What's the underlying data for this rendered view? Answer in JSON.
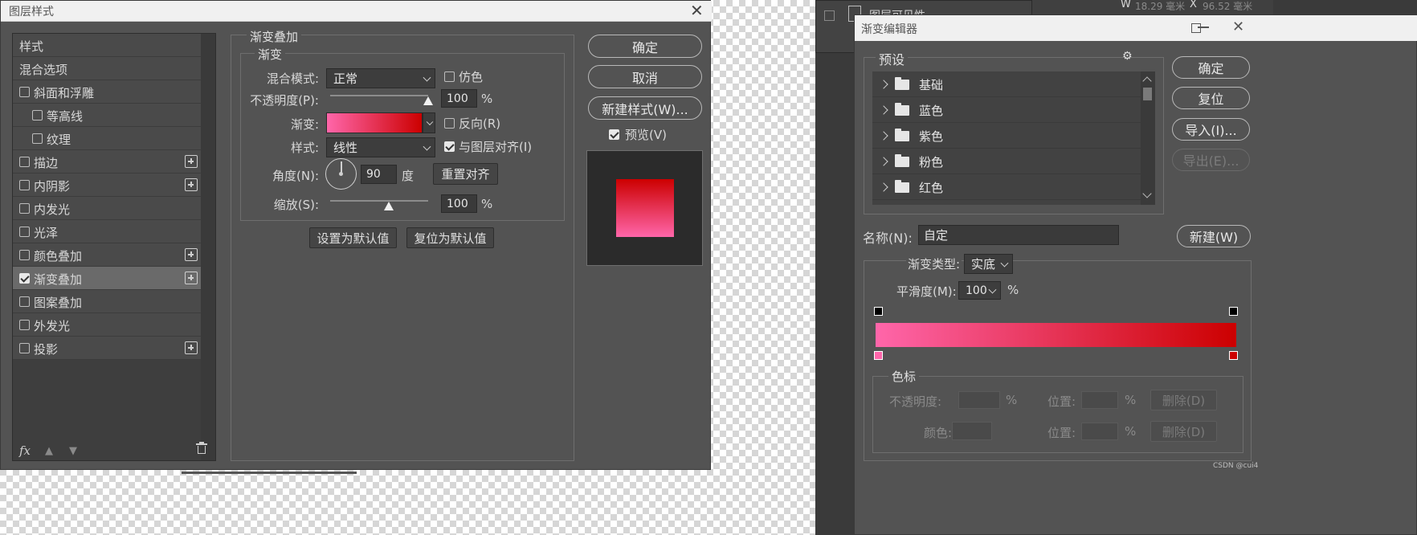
{
  "colors": {
    "panel_bg": "#535353",
    "dark_bg": "#3f3f3f",
    "gradient_start": "#ff66aa",
    "gradient_end": "#cc0000",
    "selected_row": "#6a6a6a"
  },
  "layer_style": {
    "title": "图层样式",
    "list": {
      "header": "样式",
      "blend_options": "混合选项",
      "items": [
        {
          "label": "斜面和浮雕",
          "checked": false,
          "plus": false
        },
        {
          "label": "等高线",
          "checked": false,
          "plus": false
        },
        {
          "label": "纹理",
          "checked": false,
          "plus": false
        },
        {
          "label": "描边",
          "checked": false,
          "plus": true
        },
        {
          "label": "内阴影",
          "checked": false,
          "plus": true
        },
        {
          "label": "内发光",
          "checked": false,
          "plus": false
        },
        {
          "label": "光泽",
          "checked": false,
          "plus": false
        },
        {
          "label": "颜色叠加",
          "checked": false,
          "plus": true
        },
        {
          "label": "渐变叠加",
          "checked": true,
          "plus": true
        },
        {
          "label": "图案叠加",
          "checked": false,
          "plus": false
        },
        {
          "label": "外发光",
          "checked": false,
          "plus": false
        },
        {
          "label": "投影",
          "checked": false,
          "plus": true
        }
      ],
      "fx": "fx"
    },
    "gradient_overlay": {
      "section_title": "渐变叠加",
      "group_title": "渐变",
      "blend_mode_label": "混合模式:",
      "blend_mode_value": "正常",
      "dither_label": "仿色",
      "opacity_label": "不透明度(P):",
      "opacity_value": "100",
      "opacity_unit": "%",
      "opacity_fraction": 1.0,
      "gradient_label": "渐变:",
      "reverse_label": "反向(R)",
      "style_label": "样式:",
      "style_value": "线性",
      "align_label": "与图层对齐(I)",
      "angle_label": "角度(N):",
      "angle_value": "90",
      "angle_unit": "度",
      "reset_align": "重置对齐",
      "scale_label": "缩放(S):",
      "scale_value": "100",
      "scale_unit": "%",
      "scale_fraction": 0.6,
      "set_default": "设置为默认值",
      "reset_default": "复位为默认值"
    },
    "buttons": {
      "ok": "确定",
      "cancel": "取消",
      "new_style": "新建样式(W)...",
      "preview": "预览(V)"
    }
  },
  "background_window": {
    "layer_visibility": "图层可见性",
    "w_label": "W",
    "w_value": "18.29 毫米",
    "x_label": "X",
    "x_value": "96.52 毫米"
  },
  "gradient_editor": {
    "title": "渐变编辑器",
    "presets_title": "预设",
    "presets": [
      "基础",
      "蓝色",
      "紫色",
      "粉色",
      "红色"
    ],
    "name_label": "名称(N):",
    "name_value": "自定",
    "new_button": "新建(W)",
    "type_label": "渐变类型:",
    "type_value": "实底",
    "smooth_label": "平滑度(M):",
    "smooth_value": "100",
    "smooth_unit": "%",
    "stops_group": "色标",
    "stop_opacity_label": "不透明度:",
    "stop_opacity_unit": "%",
    "position_label": "位置:",
    "position_unit": "%",
    "delete_label": "删除(D)",
    "color_label": "颜色:",
    "buttons": {
      "ok": "确定",
      "reset": "复位",
      "import": "导入(I)...",
      "export": "导出(E)..."
    }
  },
  "watermark": "CSDN @cui4"
}
